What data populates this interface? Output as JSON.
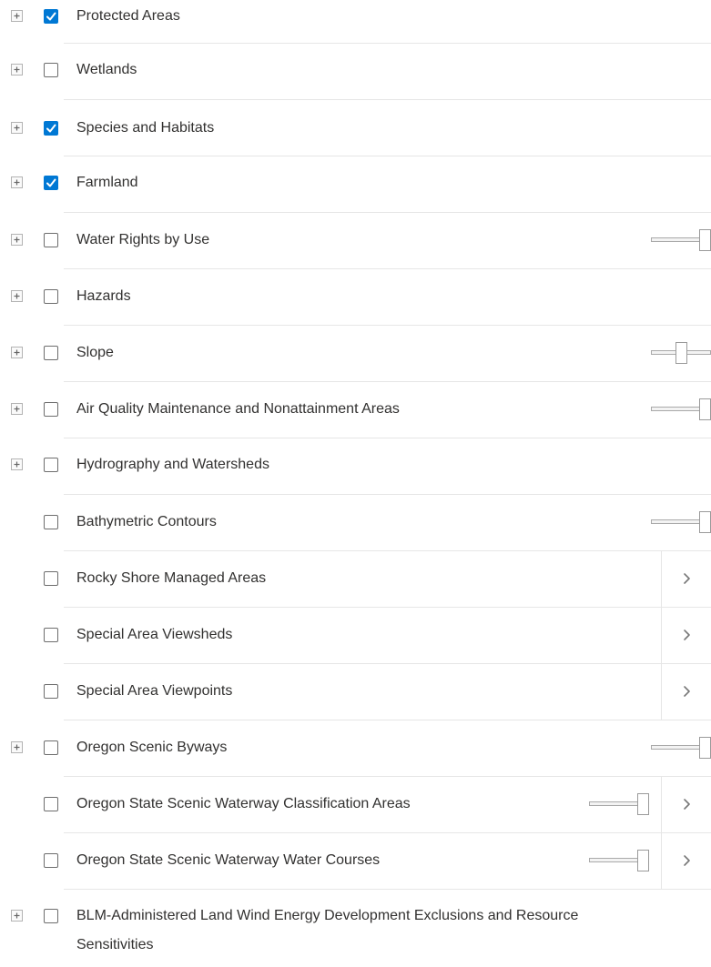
{
  "layers": [
    {
      "label": "Protected Areas",
      "checked": true,
      "expandable": true,
      "opacity": null,
      "submenu": false
    },
    {
      "label": "Wetlands",
      "checked": false,
      "expandable": true,
      "opacity": null,
      "submenu": false
    },
    {
      "label": "Species and Habitats",
      "checked": true,
      "expandable": true,
      "opacity": null,
      "submenu": false
    },
    {
      "label": "Farmland",
      "checked": true,
      "expandable": true,
      "opacity": null,
      "submenu": false
    },
    {
      "label": "Water Rights by Use",
      "checked": false,
      "expandable": true,
      "opacity": 1.0,
      "submenu": false
    },
    {
      "label": "Hazards",
      "checked": false,
      "expandable": true,
      "opacity": null,
      "submenu": false
    },
    {
      "label": "Slope",
      "checked": false,
      "expandable": true,
      "opacity": 0.5,
      "submenu": false
    },
    {
      "label": "Air Quality Maintenance and Nonattainment Areas",
      "checked": false,
      "expandable": true,
      "opacity": 1.0,
      "submenu": false
    },
    {
      "label": "Hydrography and Watersheds",
      "checked": false,
      "expandable": true,
      "opacity": null,
      "submenu": false
    },
    {
      "label": "Bathymetric Contours",
      "checked": false,
      "expandable": false,
      "opacity": 1.0,
      "submenu": false
    },
    {
      "label": "Rocky Shore Managed Areas",
      "checked": false,
      "expandable": false,
      "opacity": null,
      "submenu": true
    },
    {
      "label": "Special Area Viewsheds",
      "checked": false,
      "expandable": false,
      "opacity": null,
      "submenu": true
    },
    {
      "label": "Special Area Viewpoints",
      "checked": false,
      "expandable": false,
      "opacity": null,
      "submenu": true
    },
    {
      "label": "Oregon Scenic Byways",
      "checked": false,
      "expandable": true,
      "opacity": 1.0,
      "submenu": false
    },
    {
      "label": "Oregon State Scenic Waterway Classification Areas",
      "checked": false,
      "expandable": false,
      "opacity": 1.0,
      "submenu": true
    },
    {
      "label": "Oregon State Scenic Waterway Water Courses",
      "checked": false,
      "expandable": false,
      "opacity": 1.0,
      "submenu": true
    },
    {
      "label": "BLM-Administered Land Wind Energy Development Exclusions and Resource Sensitivities",
      "checked": false,
      "expandable": true,
      "opacity": null,
      "submenu": false
    }
  ],
  "icons": {
    "expand": "plus-box-icon",
    "check": "checkmark-icon",
    "submenu": "chevron-right-icon"
  },
  "colors": {
    "checked": "#0078d4",
    "text": "#323130",
    "divider": "#e6e6e6"
  }
}
